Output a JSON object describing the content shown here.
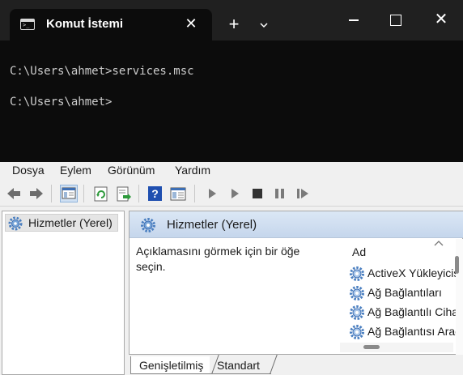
{
  "terminal": {
    "tab_title": "Komut İstemi",
    "tab_close": "✕",
    "new_tab": "+",
    "window_close": "✕",
    "lines": [
      "C:\\Users\\ahmet>services.msc",
      "C:\\Users\\ahmet>"
    ]
  },
  "services": {
    "menu": [
      "Dosya",
      "Eylem",
      "Görünüm",
      "Yardım"
    ],
    "tree": {
      "item": "Hizmetler (Yerel)"
    },
    "header": {
      "title": "Hizmetler (Yerel)"
    },
    "description": "Açıklamasını görmek için bir öğe seçin.",
    "list": {
      "column": "Ad",
      "items": [
        "ActiveX Yükleyicisi",
        "Ağ Bağlantıları",
        "Ağ Bağlantılı Cihaz",
        "Ağ Bağlantısı Aracısı"
      ]
    },
    "tabs": [
      "Genişletilmiş",
      "Standart"
    ]
  },
  "colors": {
    "terminal_bg": "#0c0c0c",
    "terminal_titlebar": "#202020",
    "header_gradient": "#c5d6ec",
    "gear": "#4a7fc0"
  },
  "icons": [
    "terminal-icon",
    "back-icon",
    "forward-icon",
    "show-hide-tree-icon",
    "refresh-icon",
    "export-list-icon",
    "help-icon",
    "properties-icon",
    "start-icon",
    "start-paused-icon",
    "stop-icon",
    "pause-icon",
    "restart-icon",
    "gear-icon"
  ]
}
